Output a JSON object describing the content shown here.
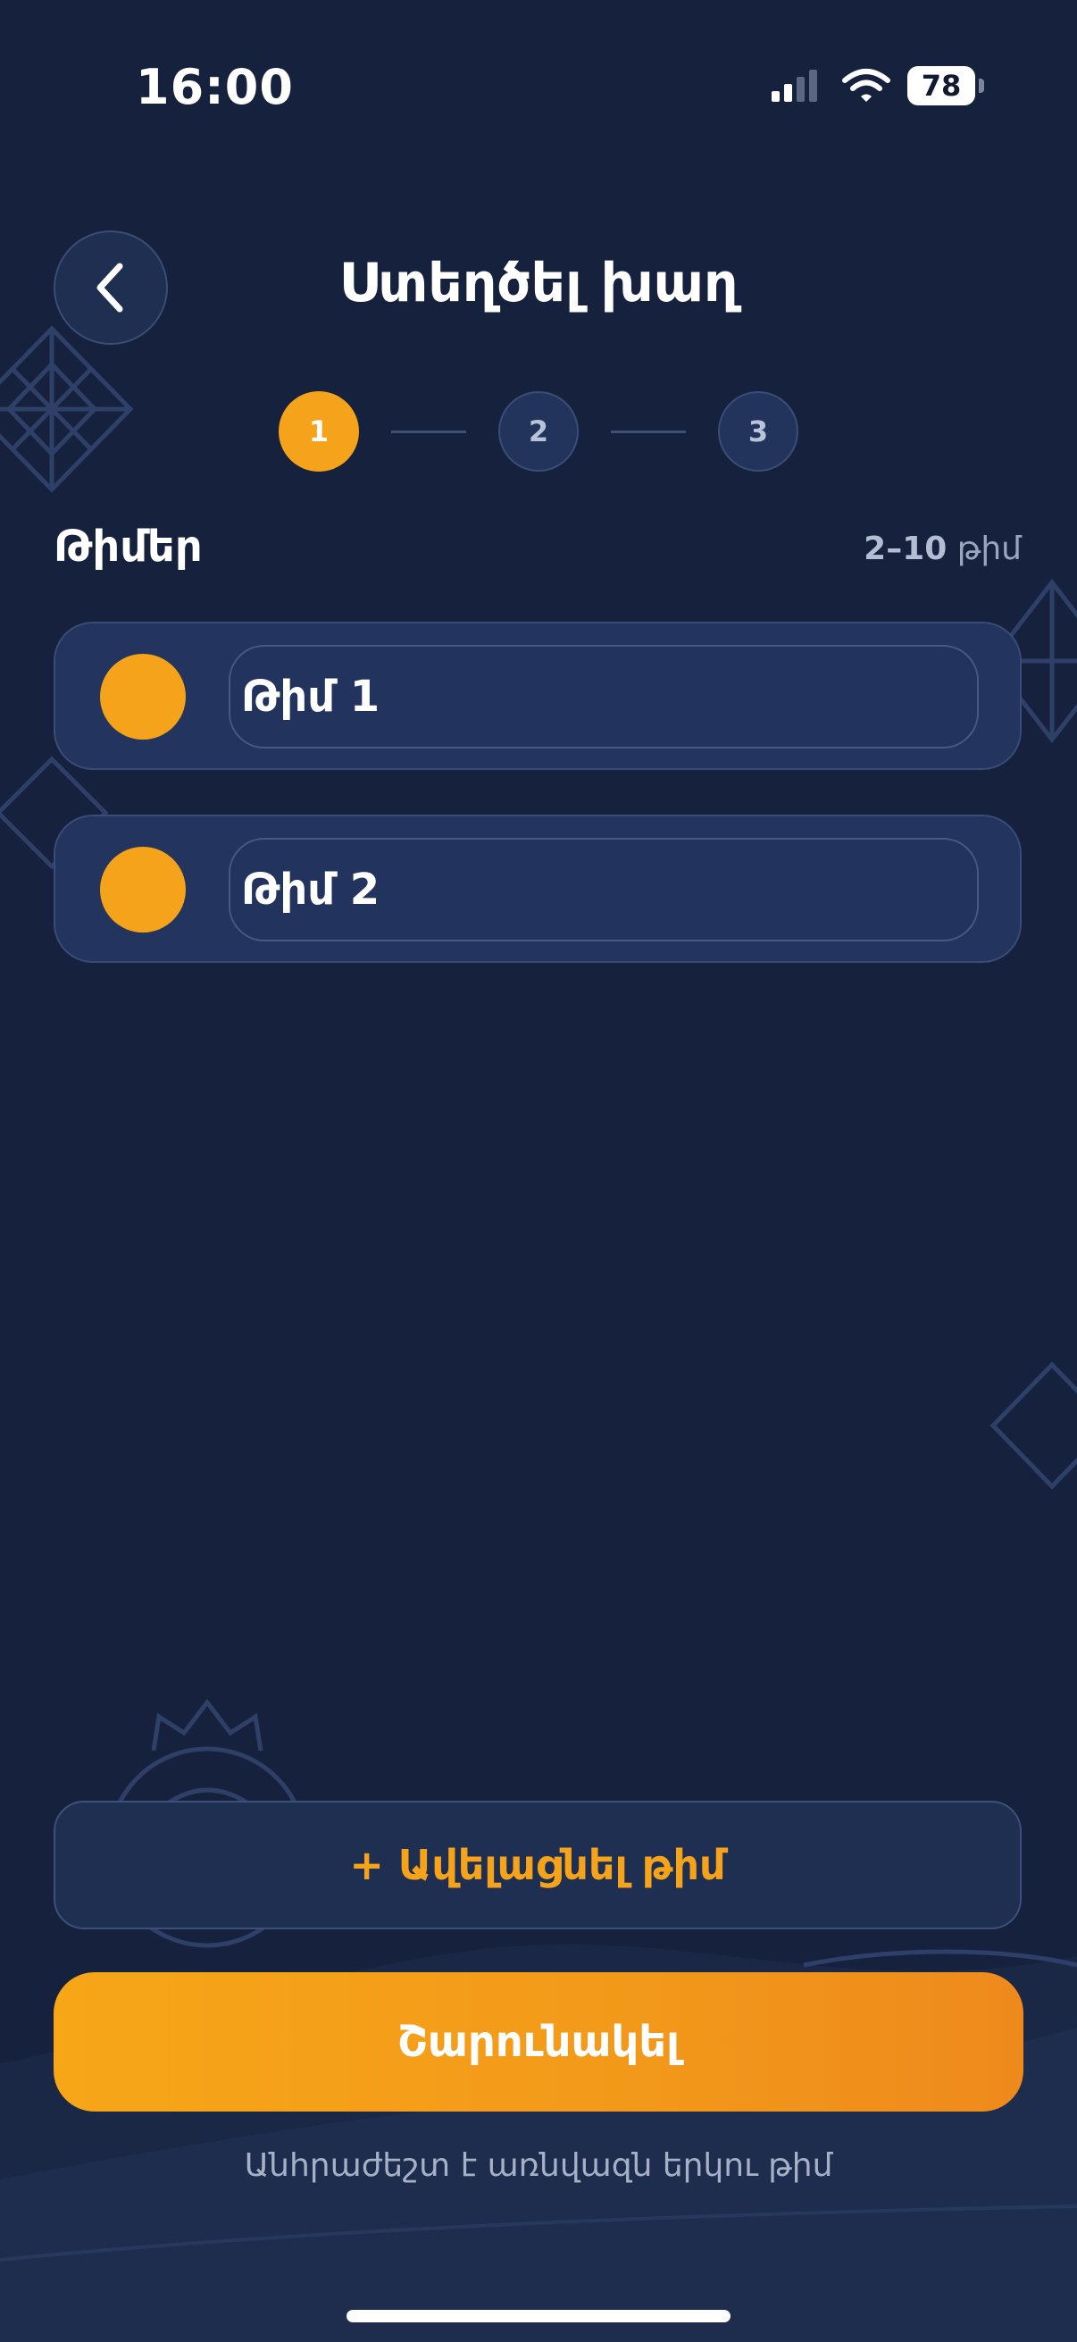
{
  "status_bar": {
    "time": "16:00",
    "battery": "78"
  },
  "header": {
    "title": "Ստեղծել խաղ"
  },
  "stepper": {
    "steps": [
      "1",
      "2",
      "3"
    ],
    "active_step": 1
  },
  "teams": {
    "title": "Թիմեր",
    "range_bold": "2–10",
    "range_unit": "թիմ",
    "items": [
      {
        "name": "Թիմ 1",
        "color": "#f5a31a"
      },
      {
        "name": "Թիմ 2",
        "color": "#f5a31a"
      }
    ]
  },
  "actions": {
    "add_team_label": "+ Ավելացնել թիմ",
    "start_label": "Շարունակել",
    "hint": "Անհրաժեշտ է առնվազն երկու թիմ"
  },
  "colors": {
    "accent": "#f5a31a",
    "background": "#15213d",
    "card": "#23355e"
  },
  "icons": [
    "back-chevron-icon",
    "signal-icon",
    "wifi-icon",
    "battery-icon"
  ]
}
